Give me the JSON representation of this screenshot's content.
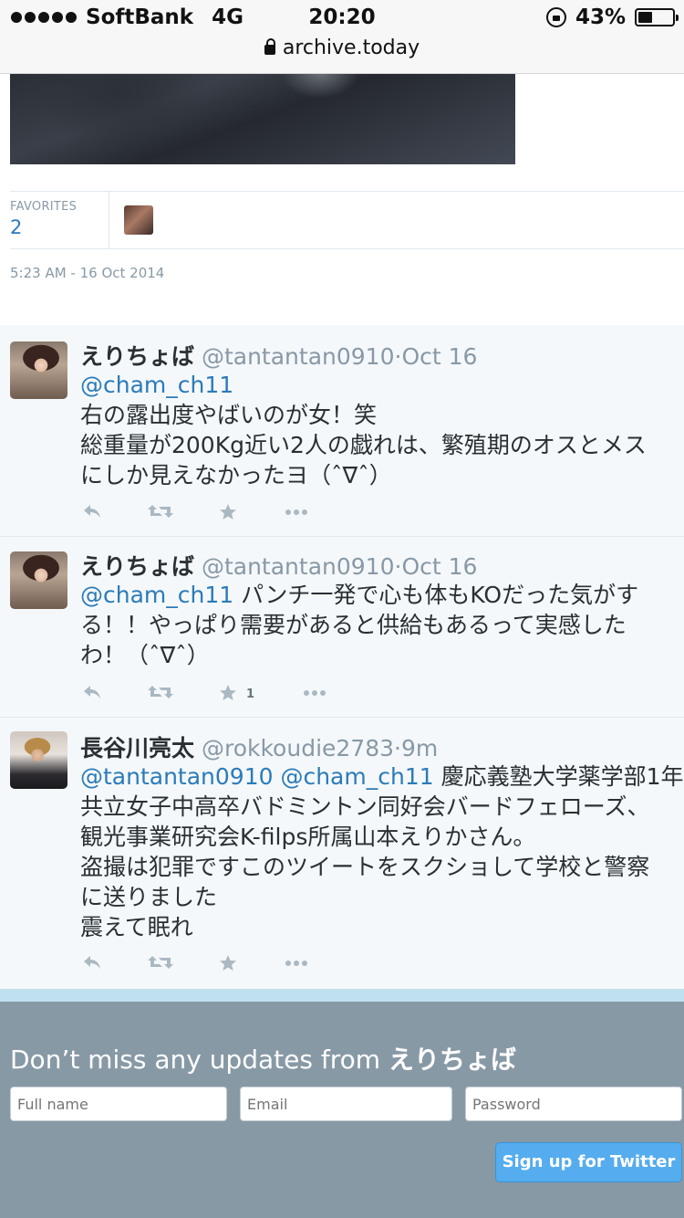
{
  "status_bar": {
    "carrier": "SoftBank",
    "network": "4G",
    "time": "20:20",
    "battery": "43%",
    "battery_level": 0.43,
    "url": "archive.today"
  },
  "tweet_detail": {
    "favorites_label": "FAVORITES",
    "favorites_count": "2",
    "timestamp": "5:23 AM - 16 Oct 2014"
  },
  "replies": [
    {
      "name": "えりちょば",
      "handle": "@tantantan0910",
      "dot": "·",
      "time": "Oct 16",
      "lines": [
        [
          "@cham_ch11",
          ""
        ],
        [
          "",
          "右の露出度やばいのが女！笑"
        ],
        [
          "",
          "総重量が200Kg近い2人の戯れは、繁殖期のオスとメス"
        ],
        [
          "",
          "にしか見えなかったヨ（ˆ∇ˆ）"
        ]
      ],
      "fav_count": ""
    },
    {
      "name": "えりちょば",
      "handle": "@tantantan0910",
      "dot": "·",
      "time": "Oct 16",
      "lines": [
        [
          "@cham_ch11",
          " パンチ一発で心も体もKOだった気がす"
        ],
        [
          "",
          "る！！やっぱり需要があると供給もあるって実感した"
        ],
        [
          "",
          "わ！（ˆ∇ˆ）"
        ]
      ],
      "fav_count": "1"
    },
    {
      "name": "長谷川亮太",
      "handle": "@rokkoudie2783",
      "dot": "·",
      "time": "9m",
      "lines": [
        [
          "@tantantan0910 @cham_ch11",
          " 慶応義塾大学薬学部1年"
        ],
        [
          "",
          "共立女子中高卒バドミントン同好会バードフェローズ、"
        ],
        [
          "",
          "観光事業研究会K-filps所属山本えりかさん。"
        ],
        [
          "",
          "盗撮は犯罪ですこのツイートをスクショして学校と警察"
        ],
        [
          "",
          "に送りました"
        ],
        [
          "",
          "震えて眠れ"
        ]
      ],
      "fav_count": ""
    }
  ],
  "signup": {
    "title_prefix": "Don’t miss any updates from ",
    "title_name": "えりちょば",
    "full_name_placeholder": "Full name",
    "email_placeholder": "Email",
    "password_placeholder": "Password",
    "button_label": "Sign up for Twitter"
  },
  "icons": [
    "reply-icon",
    "retweet-icon",
    "favorite-icon",
    "more-icon"
  ],
  "colors": {
    "link": "#2b7bb9",
    "muted": "#8899a6",
    "signup_bg": "#8899a6",
    "button": "#55acee"
  }
}
